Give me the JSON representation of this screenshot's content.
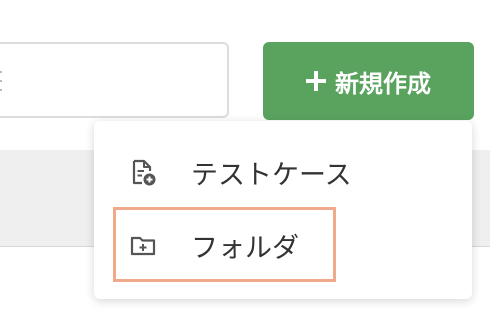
{
  "toolbar": {
    "new_button_label": "新規作成",
    "new_button_icon": "plus-icon",
    "new_button_color": "#5aa35f"
  },
  "dropdown": {
    "items": [
      {
        "label": "テストケース",
        "icon": "document-add-icon"
      },
      {
        "label": "フォルダ",
        "icon": "folder-add-icon"
      }
    ]
  },
  "highlight": {
    "target": "フォルダ",
    "color": "#f0a98a"
  }
}
